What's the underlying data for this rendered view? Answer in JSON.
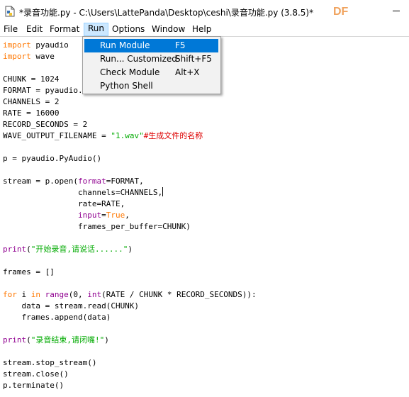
{
  "window": {
    "title": "*录音功能.py - C:\\Users\\LattePanda\\Desktop\\ceshi\\录音功能.py (3.8.5)*",
    "watermark": "DF"
  },
  "menubar": {
    "items": [
      "File",
      "Edit",
      "Format",
      "Run",
      "Options",
      "Window",
      "Help"
    ],
    "active": "Run"
  },
  "run_menu": {
    "items": [
      {
        "label": "Run Module",
        "shortcut": "F5"
      },
      {
        "label": "Run... Customized",
        "shortcut": "Shift+F5"
      },
      {
        "label": "Check Module",
        "shortcut": "Alt+X"
      },
      {
        "label": "Python Shell",
        "shortcut": ""
      }
    ],
    "highlighted": "Run Module"
  },
  "editor": {
    "lines": [
      "import pyaudio",
      "import wave",
      "",
      "CHUNK = 1024",
      "FORMAT = pyaudio.paInt16",
      "CHANNELS = 2",
      "RATE = 16000",
      "RECORD_SECONDS = 2",
      "WAVE_OUTPUT_FILENAME = \"1.wav\"#生成文件的名称",
      "",
      "p = pyaudio.PyAudio()",
      "",
      "stream = p.open(format=FORMAT,",
      "                channels=CHANNELS,",
      "                rate=RATE,",
      "                input=True,",
      "                frames_per_buffer=CHUNK)",
      "",
      "print(\"开始录音,请说话......\")",
      "",
      "frames = []",
      "",
      "for i in range(0, int(RATE / CHUNK * RECORD_SECONDS)):",
      "    data = stream.read(CHUNK)",
      "    frames.append(data)",
      "",
      "print(\"录音结束,请闭嘴!\")",
      "",
      "stream.stop_stream()",
      "stream.close()",
      "p.terminate()"
    ],
    "cursor_line": 13
  },
  "colors": {
    "keyword": "#ff7700",
    "builtin": "#900090",
    "string": "#00aa00",
    "comment": "#dd0000",
    "menu_highlight": "#0078d7",
    "watermark": "#f0a35e"
  }
}
